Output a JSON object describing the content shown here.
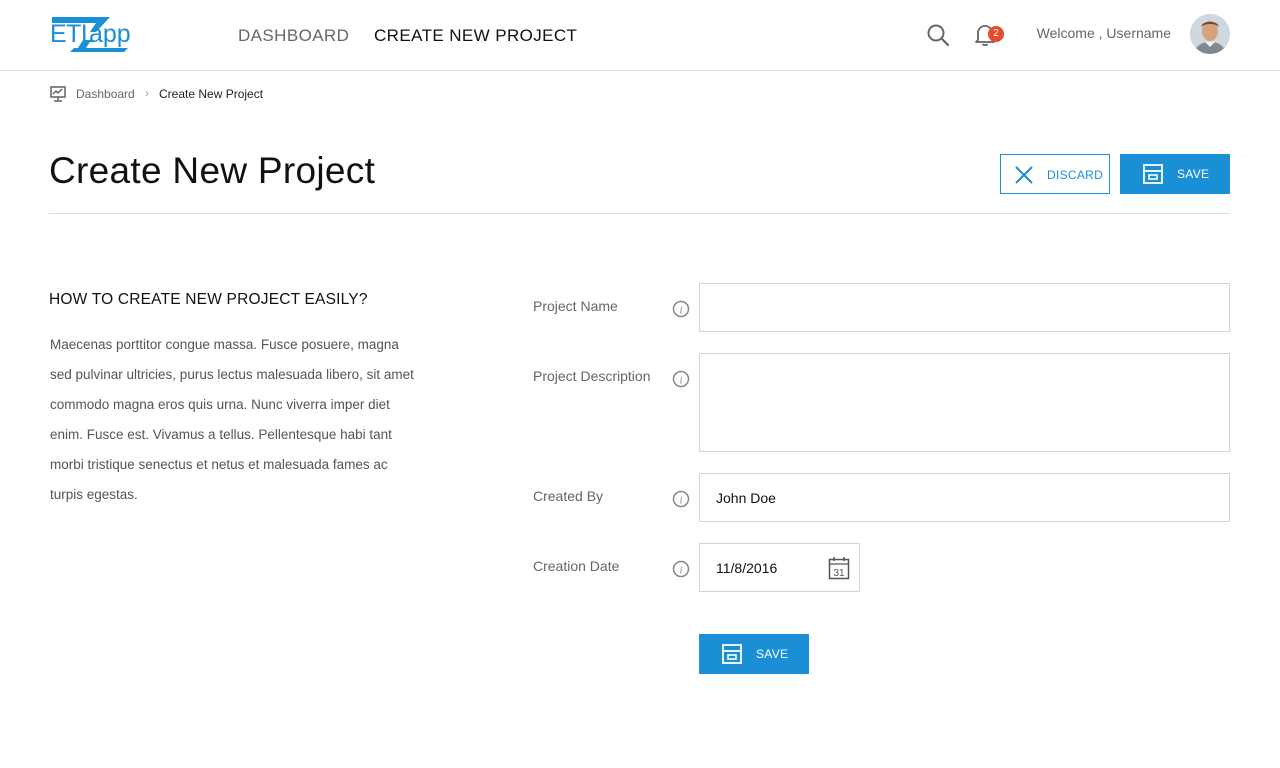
{
  "header": {
    "logo": {
      "part1": "ETL",
      "part2": "app"
    },
    "nav": [
      {
        "label": "DASHBOARD"
      },
      {
        "label": "CREATE NEW PROJECT"
      }
    ],
    "notification_count": "2",
    "welcome": "Welcome , Username"
  },
  "breadcrumb": {
    "items": [
      {
        "label": "Dashboard"
      },
      {
        "label": "Create New Project"
      }
    ],
    "separator": "›"
  },
  "page": {
    "title": "Create New Project",
    "discard_label": "DISCARD",
    "save_label": "SAVE"
  },
  "help": {
    "title": "HOW TO CREATE NEW PROJECT EASILY?",
    "text": "Maecenas porttitor congue massa. Fusce posuere, magna sed pulvinar ultricies, purus lectus malesuada libero, sit amet commodo magna eros quis urna. Nunc viverra imper diet enim. Fusce est. Vivamus a tellus. Pellentesque habi tant morbi tristique senectus et netus et malesuada fames ac turpis egestas."
  },
  "form": {
    "project_name": {
      "label": "Project Name",
      "value": ""
    },
    "project_description": {
      "label": "Project Description",
      "value": ""
    },
    "created_by": {
      "label": "Created By",
      "value": "John Doe"
    },
    "creation_date": {
      "label": "Creation Date",
      "value": "11/8/2016",
      "calendar_day": "31"
    },
    "save_label": "SAVE"
  },
  "colors": {
    "accent": "#1a8fd6",
    "badge": "#e54b2c",
    "border": "#d4d4d4"
  },
  "icons": [
    "search-icon",
    "bell-icon",
    "dashboard-icon",
    "close-icon",
    "save-icon",
    "info-icon",
    "calendar-icon"
  ]
}
